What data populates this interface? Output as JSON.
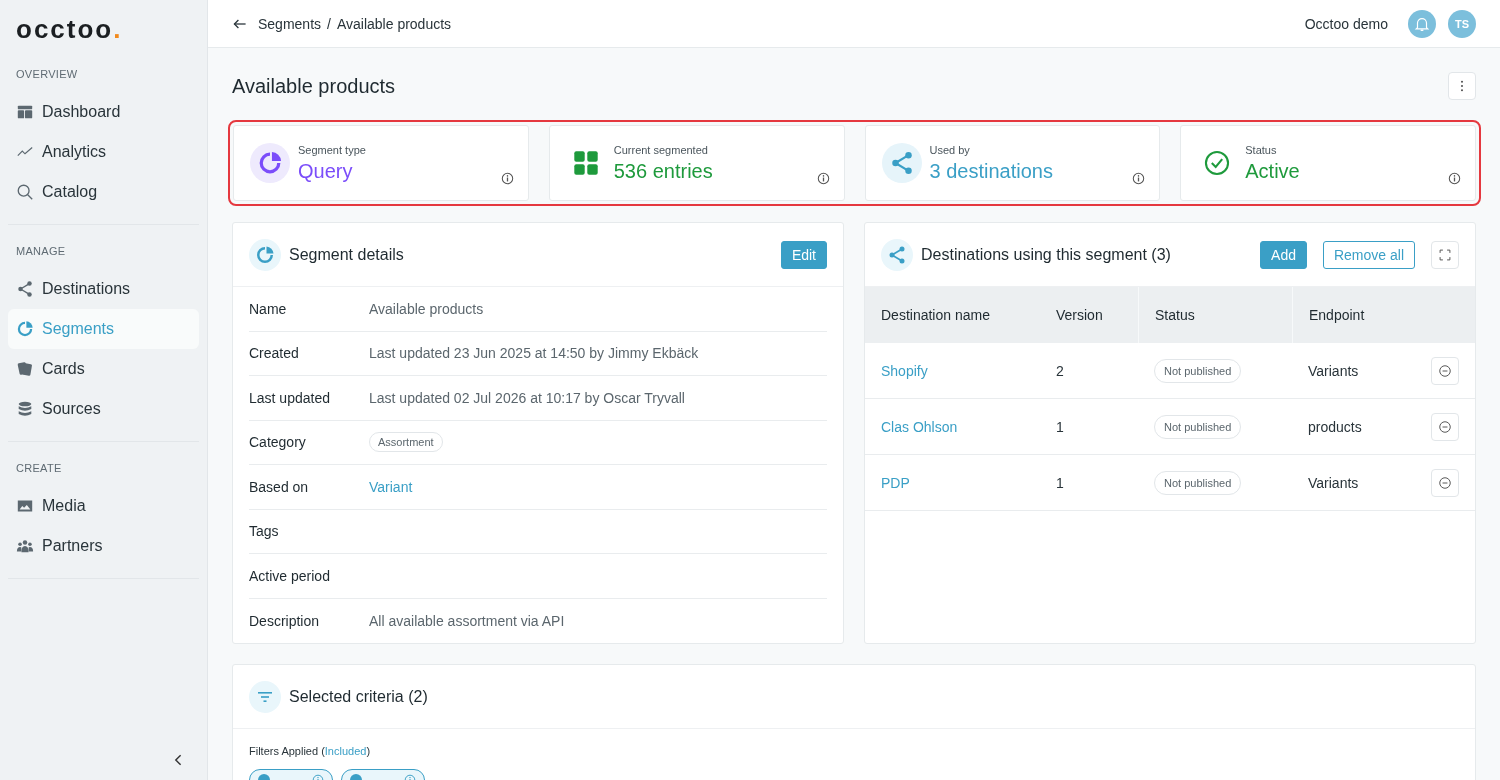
{
  "logo": {
    "text": "occtoo",
    "dot": "."
  },
  "sidebar": {
    "sections": [
      {
        "label": "OVERVIEW",
        "items": [
          {
            "label": "Dashboard",
            "selected": false
          },
          {
            "label": "Analytics",
            "selected": false
          },
          {
            "label": "Catalog",
            "selected": false
          }
        ]
      },
      {
        "label": "MANAGE",
        "items": [
          {
            "label": "Destinations",
            "selected": false
          },
          {
            "label": "Segments",
            "selected": true
          },
          {
            "label": "Cards",
            "selected": false
          },
          {
            "label": "Sources",
            "selected": false
          }
        ]
      },
      {
        "label": "CREATE",
        "items": [
          {
            "label": "Media",
            "selected": false
          },
          {
            "label": "Partners",
            "selected": false
          }
        ]
      }
    ]
  },
  "topbar": {
    "breadcrumb": [
      "Segments",
      "Available products"
    ],
    "separator": "/",
    "org": "Occtoo demo",
    "avatar": "TS"
  },
  "page": {
    "title": "Available products"
  },
  "stats": [
    {
      "kind": "pie",
      "label": "Segment type",
      "value": "Query",
      "color": "#7b4dfa"
    },
    {
      "kind": "grid",
      "label": "Current segmented",
      "value": "536 entries",
      "color": "#1e9a3c"
    },
    {
      "kind": "share",
      "label": "Used by",
      "value": "3 destinations",
      "color": "#3a9fc6"
    },
    {
      "kind": "check",
      "label": "Status",
      "value": "Active",
      "color": "#1e9a3c"
    }
  ],
  "details": {
    "title": "Segment details",
    "edit": "Edit",
    "rows": [
      {
        "label": "Name",
        "kind": "text",
        "value": "Available products"
      },
      {
        "label": "Created",
        "kind": "text",
        "value": "Last updated 23 Jun 2025 at 14:50 by Jimmy Ekbäck"
      },
      {
        "label": "Last updated",
        "kind": "text",
        "value": "Last updated 02 Jul 2026 at 10:17 by Oscar Tryvall"
      },
      {
        "label": "Category",
        "kind": "tag",
        "value": "Assortment"
      },
      {
        "label": "Based on",
        "kind": "link",
        "value": "Variant"
      },
      {
        "label": "Tags",
        "kind": "empty"
      },
      {
        "label": "Active period",
        "kind": "empty"
      },
      {
        "label": "Description",
        "kind": "text",
        "value": "All available assortment via API"
      }
    ]
  },
  "destinations": {
    "title": "Destinations using this segment (3)",
    "add": "Add",
    "remove_all": "Remove all",
    "columns": [
      "Destination name",
      "Version",
      "Status",
      "Endpoint"
    ],
    "rows": [
      {
        "name": "Shopify",
        "version": "2",
        "status": "Not published",
        "endpoint": "Variants"
      },
      {
        "name": "Clas Ohlson",
        "version": "1",
        "status": "Not published",
        "endpoint": "products"
      },
      {
        "name": "PDP",
        "version": "1",
        "status": "Not published",
        "endpoint": "Variants"
      }
    ]
  },
  "criteria": {
    "title": "Selected criteria (2)",
    "filters_prefix": "Filters Applied (",
    "filters_link": "Included",
    "filters_suffix": ")",
    "chips": [
      {
        "kind": "filter"
      },
      {
        "kind": "filter"
      }
    ]
  }
}
